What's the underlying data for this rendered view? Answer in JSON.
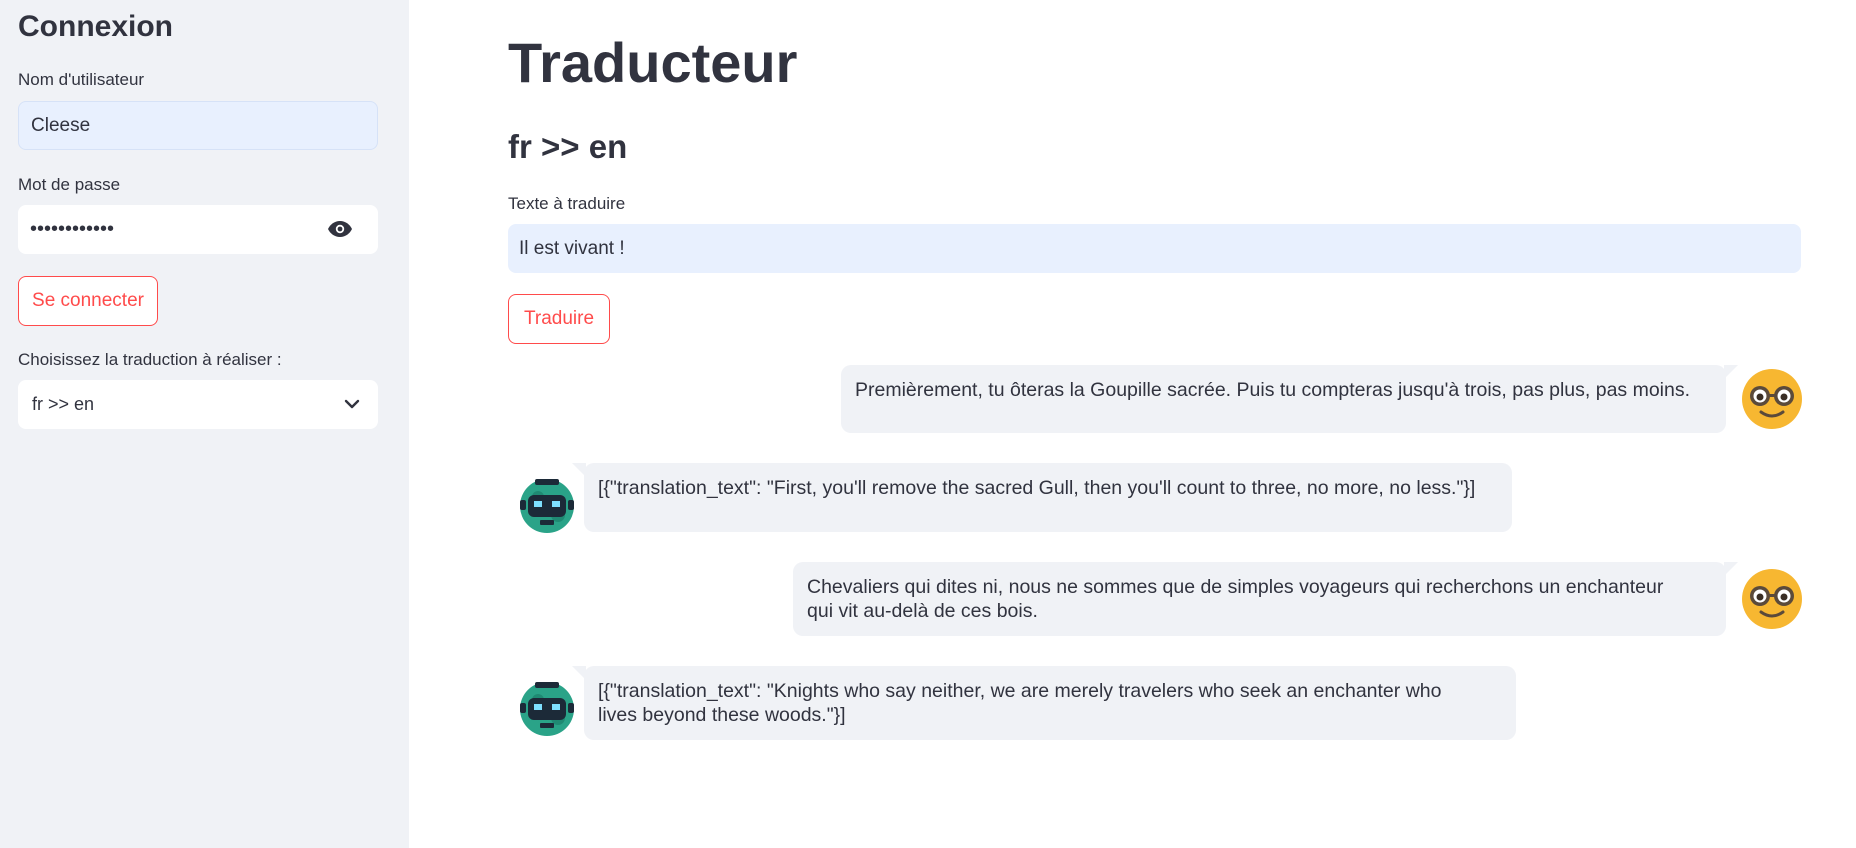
{
  "sidebar": {
    "title": "Connexion",
    "username_label": "Nom d'utilisateur",
    "username_value": "Cleese",
    "password_label": "Mot de passe",
    "password_value": "••••••••••••",
    "connect_label": "Se connecter",
    "translation_label": "Choisissez la traduction à réaliser :",
    "translation_selected": "fr >> en"
  },
  "main": {
    "title": "Traducteur",
    "subtitle": "fr >> en",
    "input_label": "Texte à traduire",
    "input_value": "Il est vivant !",
    "translate_label": "Traduire"
  },
  "chat": {
    "messages": [
      {
        "role": "user",
        "avatar_icon": "nerd-face-icon",
        "lines": [
          "Premièrement, tu ôteras la Goupille sacrée. Puis tu compteras jusqu'à trois, pas plus, pas moins."
        ]
      },
      {
        "role": "assistant",
        "avatar_icon": "robot-icon",
        "lines": [
          "[{\"translation_text\": \"First, you'll remove the sacred Gull, then you'll count to three, no more, no less.\"}]"
        ]
      },
      {
        "role": "user",
        "avatar_icon": "nerd-face-icon",
        "lines": [
          "Chevaliers qui dites ni, nous ne sommes que de simples voyageurs qui recherchons un enchanteur",
          "qui vit au-delà de ces bois."
        ]
      },
      {
        "role": "assistant",
        "avatar_icon": "robot-icon",
        "lines": [
          "[{\"translation_text\": \"Knights who say neither, we are merely travelers who seek an enchanter who",
          "lives beyond these woods.\"}]"
        ]
      }
    ]
  },
  "colors": {
    "accent": "#ff4b4b",
    "sidebar_bg": "#f0f2f6",
    "input_fill": "#e8f0fe",
    "text": "#31333f"
  }
}
